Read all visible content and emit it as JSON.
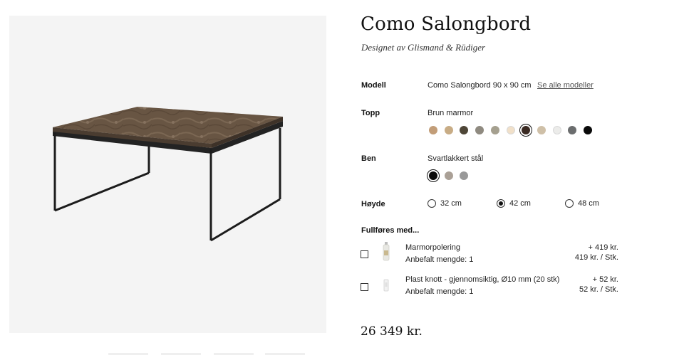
{
  "product": {
    "title": "Como Salongbord",
    "designer": "Designet av Glismand & Rüdiger"
  },
  "model": {
    "label": "Modell",
    "value": "Como Salongbord 90 x 90 cm",
    "link": "Se alle modeller"
  },
  "top": {
    "label": "Topp",
    "value": "Brun marmor",
    "swatches": [
      "#c29d78",
      "#c8ac85",
      "#4e4637",
      "#8f8a80",
      "#a5a08f",
      "#f1e0c9",
      "#3a2a22",
      "#cfc0a8",
      "#ececea",
      "#6b6d6e",
      "#0a0a0a"
    ],
    "selected_index": 6
  },
  "legs": {
    "label": "Ben",
    "value": "Svartlakkert stål",
    "swatches": [
      "#0b0b0b",
      "#aaa096",
      "#999999"
    ],
    "selected_index": 0
  },
  "height": {
    "label": "Høyde",
    "options": [
      "32 cm",
      "42 cm",
      "48 cm"
    ],
    "selected_index": 1
  },
  "addons": {
    "heading": "Fullføres med...",
    "items": [
      {
        "name": "Marmorpolering",
        "qty": "Anbefalt mengde: 1",
        "price": "+ 419 kr.",
        "unit_price": "419 kr. / Stk.",
        "checked": false
      },
      {
        "name": "Plast knott - gjennomsiktig, Ø10 mm (20 stk)",
        "qty": "Anbefalt mengde: 1",
        "price": "+ 52 kr.",
        "unit_price": "52 kr. / Stk.",
        "checked": false
      }
    ]
  },
  "price": {
    "total": "26 349 kr."
  }
}
